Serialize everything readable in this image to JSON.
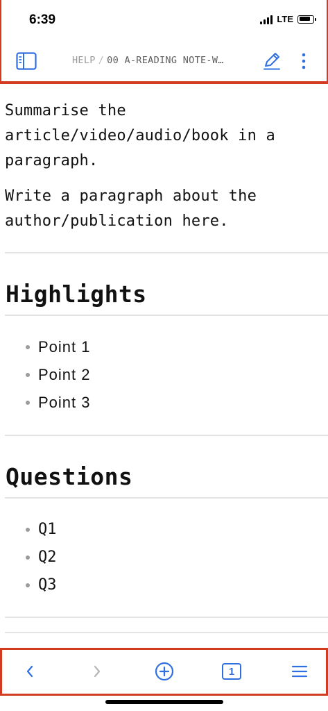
{
  "status_bar": {
    "time": "6:39",
    "network": "LTE",
    "battery_level": 0.85
  },
  "toolbar": {
    "breadcrumb_root": "HELP",
    "breadcrumb_separator": "/",
    "breadcrumb_current": "00 A-READING NOTE-W…",
    "icons": {
      "sidebar": "sidebar-toggle-icon",
      "edit": "pencil-icon",
      "more": "more-vertical-icon"
    }
  },
  "document": {
    "paragraphs": [
      "Summarise the article/video/audio/book in a paragraph.",
      "Write a paragraph about the author/publication here."
    ],
    "sections": [
      {
        "heading": "Highlights",
        "items": [
          "Point 1",
          "Point 2",
          "Point 3"
        ]
      },
      {
        "heading": "Questions",
        "items": [
          "Q1",
          "Q2",
          "Q3"
        ]
      }
    ]
  },
  "bottom_bar": {
    "tab_count": "1",
    "icons": {
      "back": "chevron-left-icon",
      "forward": "chevron-right-icon",
      "new_tab": "plus-circle-icon",
      "tabs": "tabs-icon",
      "menu": "hamburger-menu-icon"
    }
  },
  "colors": {
    "accent": "#2f6fe0",
    "highlight_border": "#d23b1f",
    "divider": "#e3e3e3",
    "disabled": "#b5b5b5"
  }
}
